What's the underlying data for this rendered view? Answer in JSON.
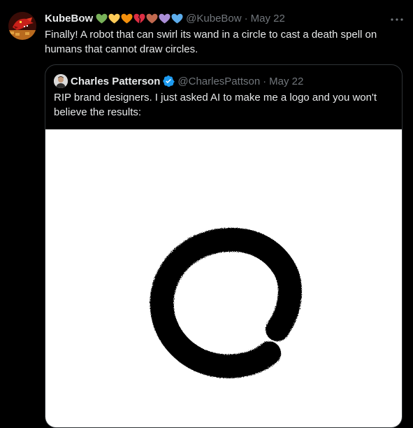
{
  "tweet": {
    "display_name": "KubeBow",
    "emojis": [
      "green-heart",
      "yellow-heart",
      "orange-heart",
      "broken-heart",
      "brown-heart",
      "purple-heart",
      "blue-heart"
    ],
    "handle": "@KubeBow",
    "separator": "·",
    "date": "May 22",
    "more_label": "···",
    "text": "Finally! A robot that can swirl its wand in a circle to cast a death spell on humans that cannot draw circles."
  },
  "quote": {
    "display_name": "Charles Patterson",
    "handle": "@CharlesPattson",
    "separator": "·",
    "date": "May 22",
    "text": "RIP brand designers. I just asked AI to make me a logo and you won't believe the results:",
    "media_icon": "enso-brush-circle"
  },
  "colors": {
    "background": "#000000",
    "text_primary": "#e7e9ea",
    "text_secondary": "#71767b",
    "border": "#2f3336",
    "verified": "#1d9bf0"
  }
}
